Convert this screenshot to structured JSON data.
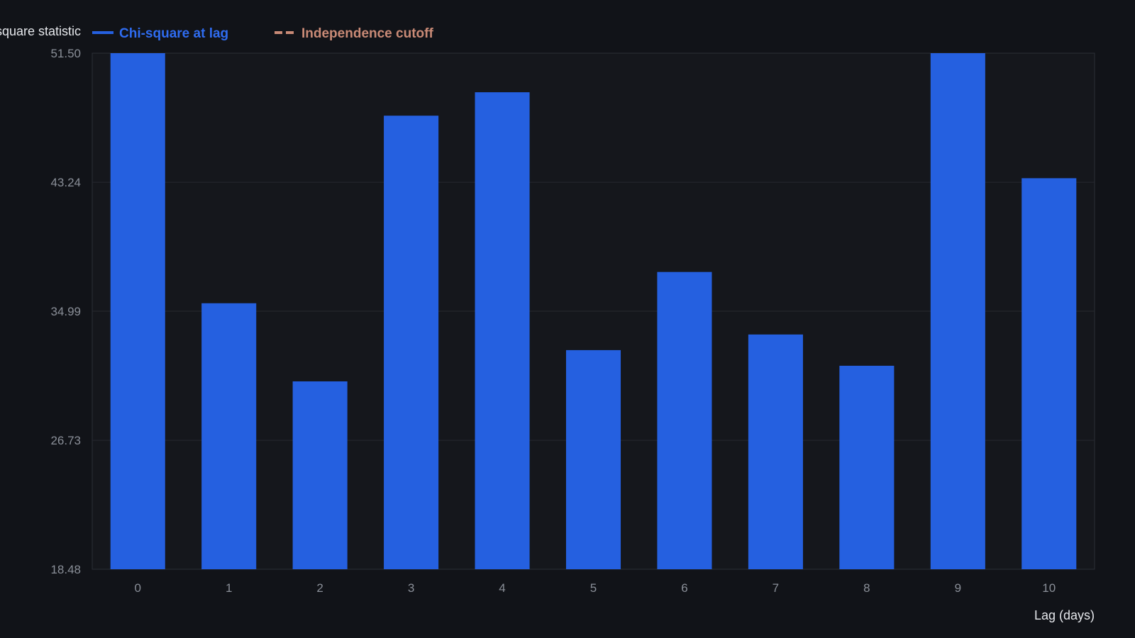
{
  "chart_data": {
    "type": "bar",
    "title": "",
    "xlabel": "Lag (days)",
    "ylabel": "Chi-square statistic",
    "categories": [
      "0",
      "1",
      "2",
      "3",
      "4",
      "5",
      "6",
      "7",
      "8",
      "9",
      "10"
    ],
    "series": [
      {
        "name": "Chi-square at lag",
        "color": "#2560e0",
        "values": [
          51.5,
          35.5,
          30.5,
          47.5,
          49.0,
          32.5,
          37.5,
          33.5,
          31.5,
          51.5,
          43.5
        ]
      }
    ],
    "reference_line": {
      "name": "Independence cutoff",
      "color": "#c98a76",
      "style": "dashed"
    },
    "ylim": [
      18.48,
      51.5
    ],
    "yticks": [
      "18.48",
      "26.73",
      "34.99",
      "43.24",
      "51.50"
    ],
    "grid": true,
    "legend_position": "top-left",
    "background_color": "#111318",
    "plot_background_color": "#15171c"
  }
}
